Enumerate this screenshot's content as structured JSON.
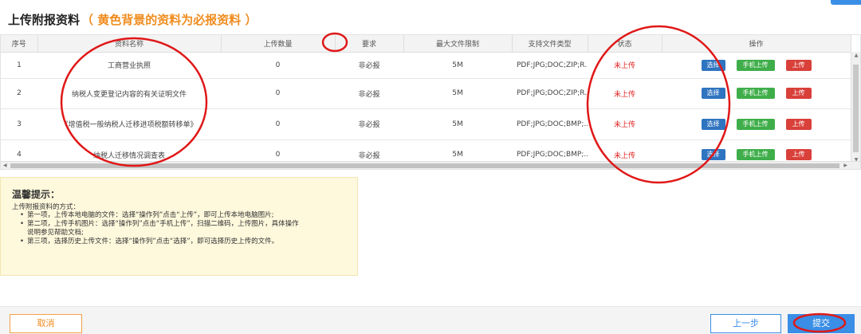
{
  "page": {
    "title": "上传附报资料",
    "subtitle": "（ 黄色背景的资料为必报资料 ）"
  },
  "table": {
    "headers": [
      "序号",
      "资料名称",
      "上传数量",
      "要求",
      "最大文件限制",
      "支持文件类型",
      "状态",
      "操作"
    ],
    "rows": [
      {
        "no": "1",
        "name": "工商营业执照",
        "count": "0",
        "req": "非必报",
        "max": "5M",
        "types": "PDF;JPG;DOC;ZIP;R...",
        "status": "未上传"
      },
      {
        "no": "2",
        "name": "纳税人变更登记内容的有关证明文件",
        "count": "0",
        "req": "非必报",
        "max": "5M",
        "types": "PDF;JPG;DOC;ZIP;R...",
        "status": "未上传"
      },
      {
        "no": "3",
        "name": "《增值税一般纳税人迁移进项税额转移单》",
        "count": "0",
        "req": "非必报",
        "max": "5M",
        "types": "PDF;JPG;DOC;BMP;...",
        "status": "未上传"
      },
      {
        "no": "4",
        "name": "纳税人迁移情况调查表",
        "count": "0",
        "req": "非必报",
        "max": "5M",
        "types": "PDF;JPG;DOC;BMP;...",
        "status": "未上传"
      }
    ],
    "actions": {
      "choose": "选择",
      "mobile": "手机上传",
      "upload": "上传"
    }
  },
  "tips": {
    "title": "温馨提示：",
    "intro": "上传附报资料的方式：",
    "items": [
      "第一项，上传本地电脑的文件：选择“操作列”点击“上传”，即可上传本地电脑图片;",
      "第二项，上传手机图片：选择“操作列”点击“手机上传”，扫描二维码，上传图片，具体操作",
      "说明参见帮助文档;",
      "第三项，选择历史上传文件：选择“操作列”点击“选择”，即可选择历史上传的文件。"
    ]
  },
  "footer": {
    "cancel": "取消",
    "prev": "上一步",
    "submit": "提交"
  },
  "colors": {
    "accent": "#3a8ee6",
    "warning": "#f08c1e",
    "status_red": "#e02020",
    "annotation_red": "#e01818"
  }
}
